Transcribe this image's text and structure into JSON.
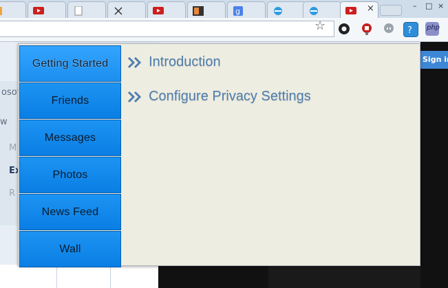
{
  "tabs": {
    "close_glyph": "×",
    "items": [
      {
        "icon": "doc-icon"
      },
      {
        "icon": "youtube-icon"
      },
      {
        "icon": "page-icon"
      },
      {
        "icon": "x-icon"
      },
      {
        "icon": "youtube-icon"
      },
      {
        "icon": "ex-icon"
      },
      {
        "icon": "google-icon"
      },
      {
        "icon": "ie-icon"
      },
      {
        "icon": "ie-icon"
      },
      {
        "icon": "youtube-icon"
      }
    ]
  },
  "window_controls": {
    "minimize": "–",
    "maximize": "□",
    "close": "×"
  },
  "toolbar": {
    "star_glyph": "☆",
    "extensions": [
      "settings-icon",
      "lastpass-icon",
      "hangouts-icon",
      "help-extension-icon",
      "php-extension-icon"
    ],
    "php_label": "php"
  },
  "page": {
    "signin_label": "Sign in",
    "fragments": [
      "osof",
      "w",
      "M",
      "Ex",
      "R"
    ]
  },
  "popup": {
    "nav": [
      {
        "label": "Getting Started",
        "active": true
      },
      {
        "label": "Friends"
      },
      {
        "label": "Messages"
      },
      {
        "label": "Photos"
      },
      {
        "label": "News Feed"
      },
      {
        "label": "Wall"
      }
    ],
    "topics": [
      {
        "label": "Introduction"
      },
      {
        "label": "Configure Privacy Settings"
      }
    ]
  },
  "colors": {
    "nav_blue": "#0a7ee4",
    "topic_text": "#4f7fae",
    "popup_bg": "#eeede1"
  }
}
